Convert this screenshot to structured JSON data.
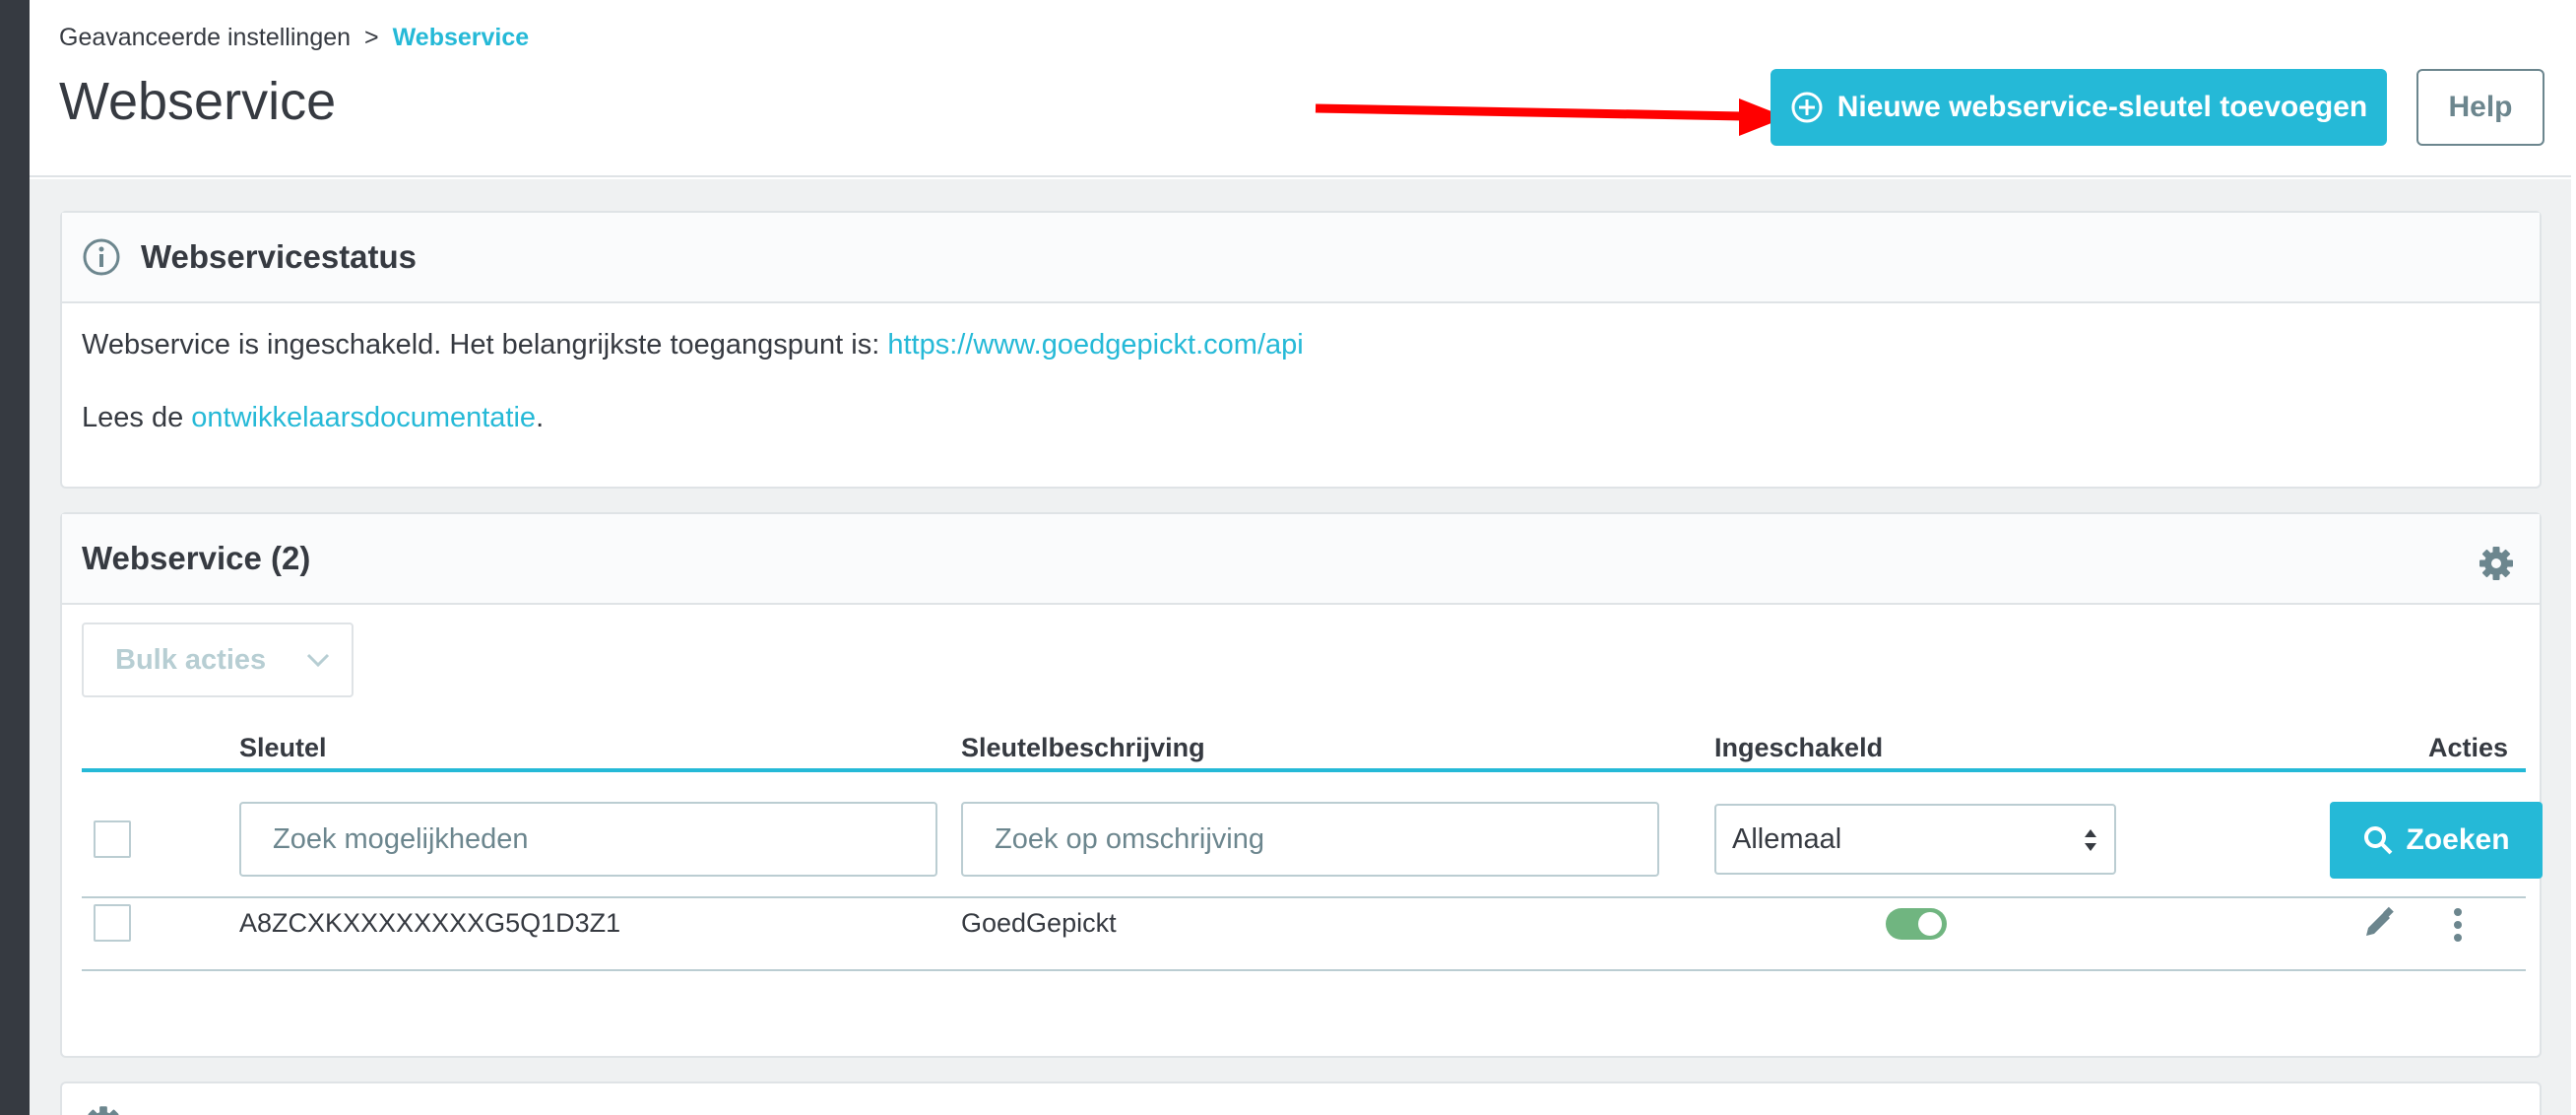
{
  "breadcrumb": {
    "parent": "Geavanceerde instellingen",
    "separator": ">",
    "current": "Webservice"
  },
  "page": {
    "title": "Webservice",
    "add_button_label": "Nieuwe webservice-sleutel toevoegen",
    "help_button_label": "Help"
  },
  "status_card": {
    "title": "Webservicestatus",
    "enabled_text": "Webservice is ingeschakeld. Het belangrijkste toegangspunt is:",
    "endpoint_link": "https://www.goedgepickt.com/api",
    "docs_prefix": "Lees de",
    "docs_link": "ontwikkelaarsdocumentatie",
    "docs_suffix": "."
  },
  "list_card": {
    "title": "Webservice (2)",
    "bulk_label": "Bulk acties",
    "columns": {
      "key": "Sleutel",
      "description": "Sleutelbeschrijving",
      "enabled": "Ingeschakeld",
      "actions": "Acties"
    },
    "filters": {
      "key_placeholder": "Zoek mogelijkheden",
      "description_placeholder": "Zoek op omschrijving",
      "enabled_selected": "Allemaal",
      "search_label": "Zoeken"
    },
    "rows": [
      {
        "key": "A8ZCXKXXXXXXXXG5Q1D3Z1",
        "description": "GoedGepickt",
        "enabled": true
      }
    ]
  },
  "colors": {
    "primary": "#25b9d7",
    "text": "#363a41",
    "muted": "#6c868e",
    "toggle_on": "#70b580",
    "annotation_arrow": "#ff0000"
  }
}
